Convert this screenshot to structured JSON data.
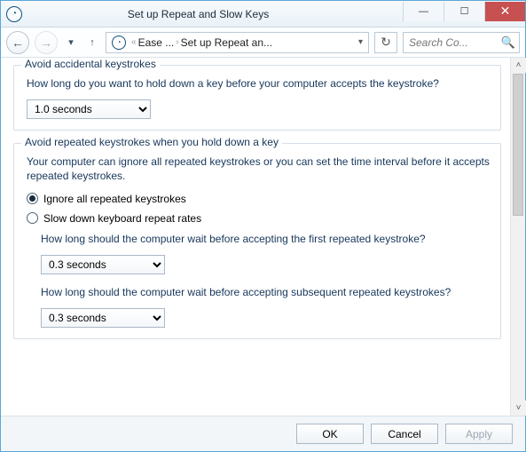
{
  "window": {
    "title": "Set up Repeat and Slow Keys"
  },
  "breadcrumb": {
    "part1": "Ease ...",
    "part2": "Set up Repeat an..."
  },
  "search": {
    "placeholder": "Search Co..."
  },
  "group1": {
    "legend": "Avoid accidental keystrokes",
    "desc": "How long do you want to hold down a key before your computer accepts the keystroke?",
    "combo_value": "1.0 seconds"
  },
  "group2": {
    "legend": "Avoid repeated keystrokes when you hold down a key",
    "desc": "Your computer can ignore all repeated keystrokes or you can set the time interval before it accepts repeated keystrokes.",
    "radio1": "Ignore all repeated keystrokes",
    "radio2": "Slow down keyboard repeat rates",
    "q1": "How long should the computer wait before accepting the first repeated keystroke?",
    "combo1_value": "0.3 seconds",
    "q2": "How long should the computer wait before accepting subsequent repeated keystrokes?",
    "combo2_value": "0.3 seconds"
  },
  "footer": {
    "ok": "OK",
    "cancel": "Cancel",
    "apply": "Apply"
  }
}
